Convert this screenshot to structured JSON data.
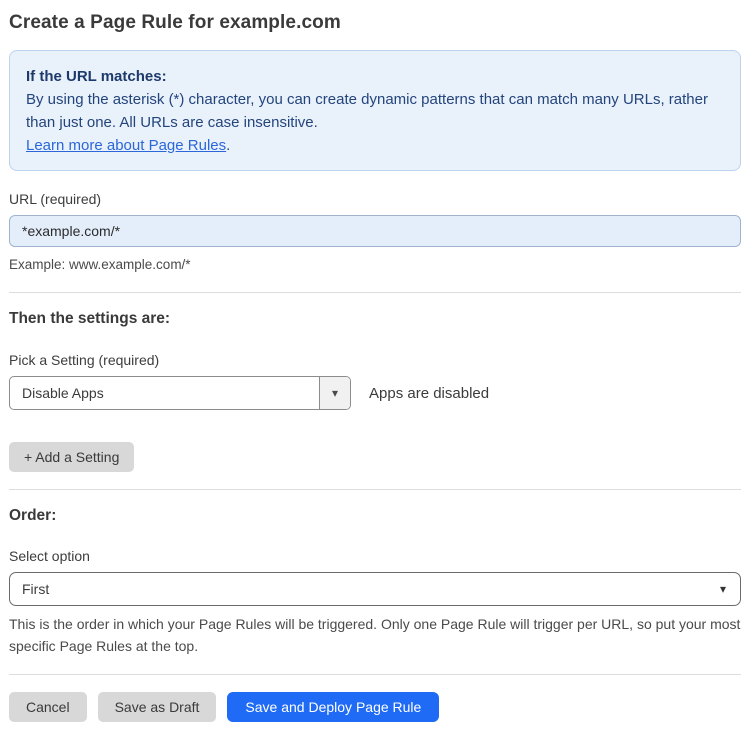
{
  "page": {
    "title": "Create a Page Rule for example.com"
  },
  "info_box": {
    "heading": "If the URL matches:",
    "body": "By using the asterisk (*) character, you can create dynamic patterns that can match many URLs, rather than just one. All URLs are case insensitive.",
    "link_label": "Learn more about Page Rules",
    "link_suffix": "."
  },
  "url_section": {
    "label": "URL (required)",
    "value": "*example.com/*",
    "example": "Example: www.example.com/*"
  },
  "settings_section": {
    "heading": "Then the settings are:",
    "picker_label": "Pick a Setting (required)",
    "picker_value": "Disable Apps",
    "status_text": "Apps are disabled",
    "add_button_label": "+ Add a Setting"
  },
  "order_section": {
    "heading": "Order:",
    "select_label": "Select option",
    "select_value": "First",
    "help_text": "This is the order in which your Page Rules will be triggered. Only one Page Rule will trigger per URL, so put your most specific Page Rules at the top."
  },
  "actions": {
    "cancel_label": "Cancel",
    "save_draft_label": "Save as Draft",
    "save_deploy_label": "Save and Deploy Page Rule"
  },
  "icons": {
    "dropdown_arrow": "▾"
  },
  "colors": {
    "info_background": "#e9f1fb",
    "info_border": "#bcd3ee",
    "info_text": "#24457c",
    "link_blue": "#2b67d8",
    "input_background": "#e4eefb",
    "primary_blue": "#1f6bf5",
    "button_gray": "#d8d8d8"
  }
}
